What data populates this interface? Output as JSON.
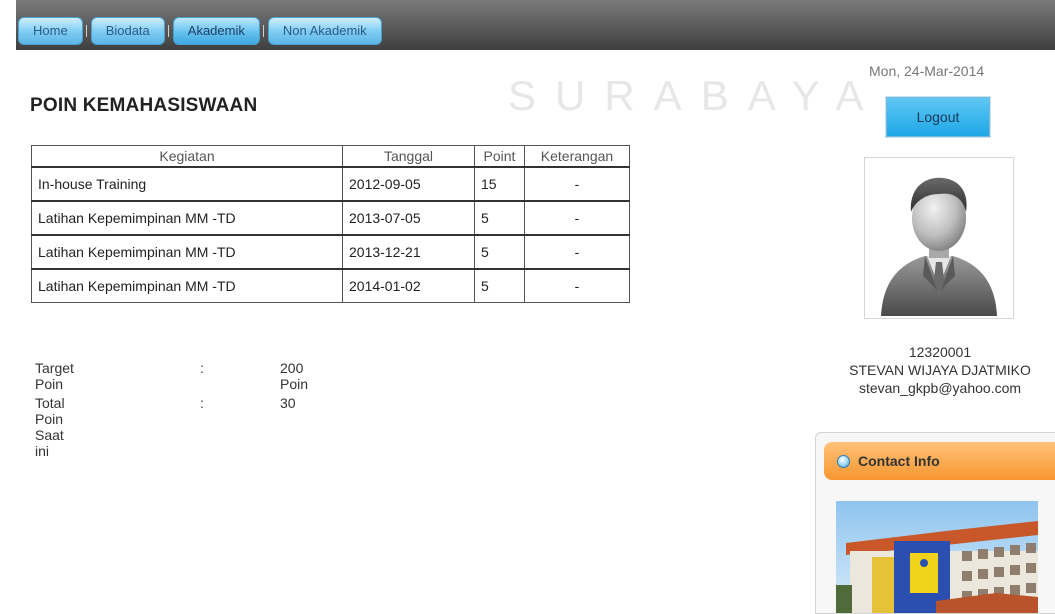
{
  "nav": {
    "items": [
      {
        "label": "Home"
      },
      {
        "label": "Biodata"
      },
      {
        "label": "Akademik"
      },
      {
        "label": "Non Akademik"
      }
    ],
    "active": "Akademik"
  },
  "watermark": {
    "text": "SURABAYA"
  },
  "page": {
    "title": "POIN KEMAHASISWAAN"
  },
  "table": {
    "headers": [
      "Kegiatan",
      "Tanggal",
      "Point",
      "Keterangan"
    ],
    "rows": [
      {
        "kegiatan": "In-house Training",
        "tanggal": "2012-09-05",
        "point": "15",
        "keterangan": "-"
      },
      {
        "kegiatan": "Latihan Kepemimpinan MM -TD",
        "tanggal": "2013-07-05",
        "point": "5",
        "keterangan": "-"
      },
      {
        "kegiatan": "Latihan Kepemimpinan MM -TD",
        "tanggal": "2013-12-21",
        "point": "5",
        "keterangan": "-"
      },
      {
        "kegiatan": "Latihan Kepemimpinan MM -TD",
        "tanggal": "2014-01-02",
        "point": "5",
        "keterangan": "-"
      }
    ]
  },
  "summary": {
    "target_label": "Target Poin",
    "target_value": "200 Poin",
    "total_label": "Total Poin Saat ini",
    "total_value": "30",
    "colon": ":"
  },
  "sidebar": {
    "date": "Mon, 24-Mar-2014",
    "logout_label": "Logout",
    "user_id": "12320001",
    "user_name": "STEVAN WIJAYA DJATMIKO",
    "user_email": "stevan_gkpb@yahoo.com",
    "contact_title": "Contact Info",
    "avatar_icon": "user-silhouette-icon",
    "contact_bullet_icon": "radio-bullet-icon"
  },
  "colors": {
    "nav_button": "#7ccbf2",
    "logout_button": "#1ea7e6",
    "contact_header": "#f7962f"
  }
}
